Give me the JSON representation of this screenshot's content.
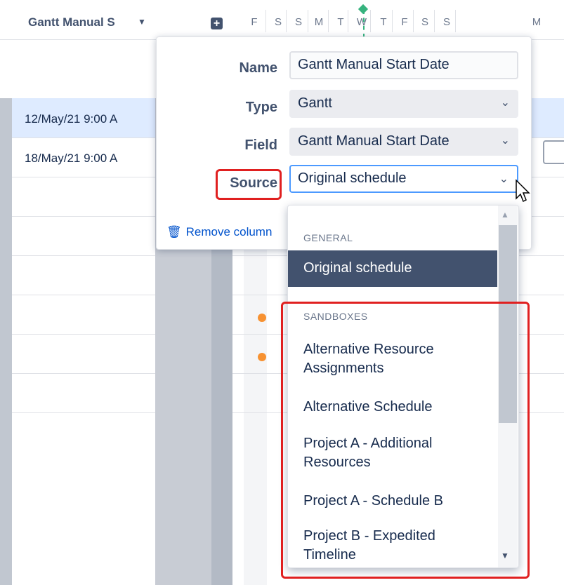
{
  "header": {
    "column_label": "Gantt Manual S",
    "days": [
      "F",
      "S",
      "S",
      "M",
      "T",
      "W",
      "T",
      "F",
      "S",
      "S",
      "M"
    ]
  },
  "rows": [
    {
      "date": "12/May/21 9:00 A"
    },
    {
      "date": "18/May/21 9:00 A"
    }
  ],
  "popover": {
    "name_label": "Name",
    "name_value": "Gantt Manual Start Date",
    "type_label": "Type",
    "type_value": "Gantt",
    "field_label": "Field",
    "field_value": "Gantt Manual Start Date",
    "source_label": "Source",
    "source_value": "Original schedule",
    "remove_label": "Remove column"
  },
  "dropdown": {
    "group_general": "GENERAL",
    "general_options": [
      "Original schedule"
    ],
    "group_sandboxes": "SANDBOXES",
    "sandbox_options": [
      "Alternative Resource Assignments",
      "Alternative Schedule",
      "Project A - Additional Resources",
      "Project A - Schedule B",
      "Project B - Expedited Timeline"
    ]
  },
  "colors": {
    "highlight": "#e02020",
    "selected_option": "#42526e",
    "today_marker": "#36b37e",
    "milestone_dot": "#f79232"
  }
}
